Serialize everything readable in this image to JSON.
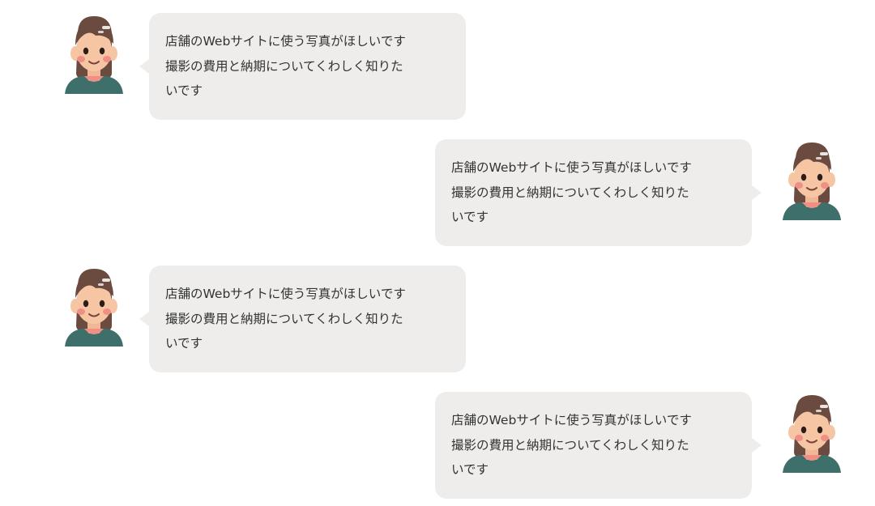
{
  "chat": {
    "messages": [
      {
        "side": "left",
        "avatar_icon": "woman-avatar-icon",
        "lines": [
          "店舗のWebサイトに使う写真がほしいです",
          "撮影の費用と納期についてくわしく知りた",
          "いです"
        ]
      },
      {
        "side": "right",
        "avatar_icon": "woman-avatar-icon",
        "lines": [
          "店舗のWebサイトに使う写真がほしいです",
          "撮影の費用と納期についてくわしく知りた",
          "いです"
        ]
      },
      {
        "side": "left",
        "avatar_icon": "woman-avatar-icon",
        "lines": [
          "店舗のWebサイトに使う写真がほしいです",
          "撮影の費用と納期についてくわしく知りた",
          "いです"
        ]
      },
      {
        "side": "right",
        "avatar_icon": "woman-avatar-icon",
        "lines": [
          "店舗のWebサイトに使う写真がほしいです",
          "撮影の費用と納期についてくわしく知りた",
          "いです"
        ]
      }
    ]
  },
  "colors": {
    "bubble_bg": "#eeedeb",
    "text": "#333333",
    "hair": "#6b4a3f",
    "skin": "#f6c6a4",
    "cheek": "#f08f85",
    "shirt": "#3f6f6a"
  }
}
